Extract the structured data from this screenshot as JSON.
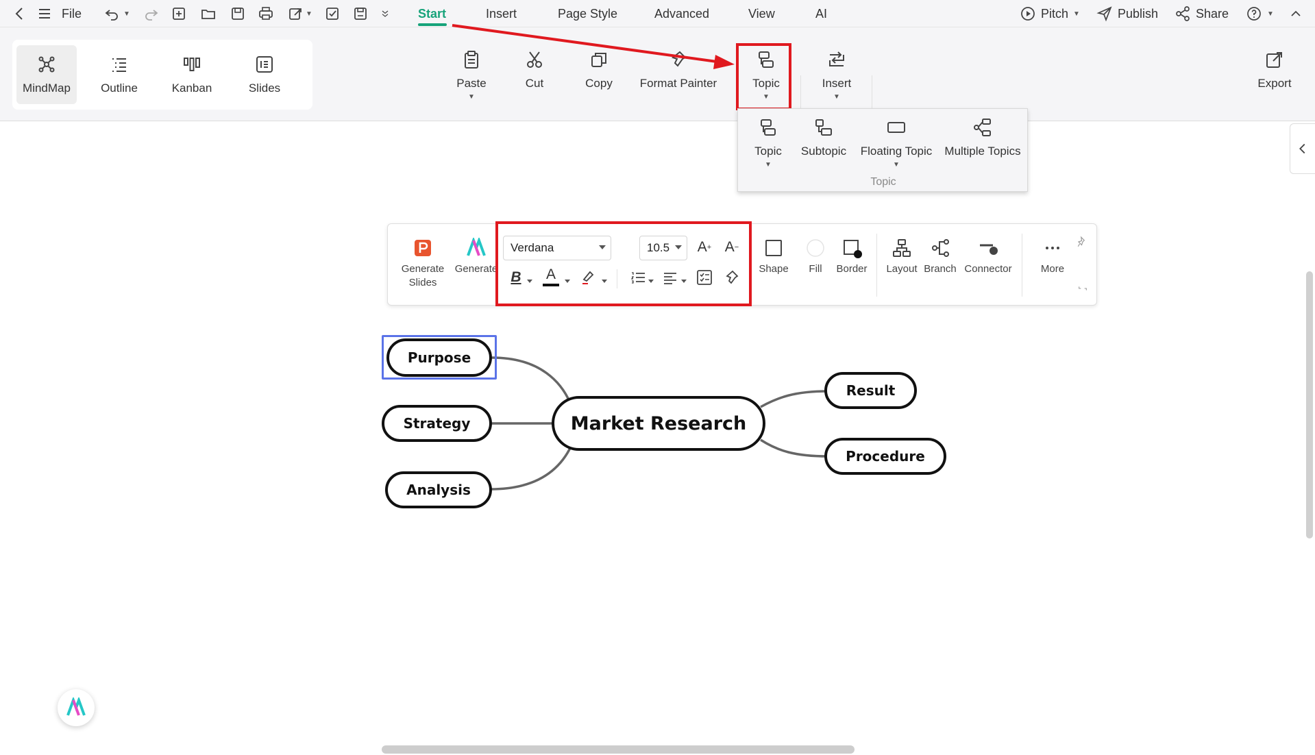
{
  "topbar": {
    "file_label": "File",
    "menus": [
      "Start",
      "Insert",
      "Page Style",
      "Advanced",
      "View",
      "AI"
    ],
    "active_menu": "Start",
    "pitch_label": "Pitch",
    "publish_label": "Publish",
    "share_label": "Share",
    "accent_color": "#17a37a"
  },
  "views": [
    {
      "label": "MindMap",
      "icon": "mindmap-icon",
      "selected": true
    },
    {
      "label": "Outline",
      "icon": "outline-icon"
    },
    {
      "label": "Kanban",
      "icon": "kanban-icon"
    },
    {
      "label": "Slides",
      "icon": "slides-icon"
    }
  ],
  "ribbon": {
    "paste": "Paste",
    "cut": "Cut",
    "copy": "Copy",
    "format_painter": "Format Painter",
    "topic": "Topic",
    "insert": "Insert",
    "export": "Export"
  },
  "topic_dropdown": {
    "items": [
      "Topic",
      "Subtopic",
      "Floating Topic",
      "Multiple Topics"
    ],
    "caption": "Topic"
  },
  "toolbar": {
    "generate_slides": "Generate Slides",
    "generate": "Generate",
    "font": "Verdana",
    "font_size": "10.5",
    "shape": "Shape",
    "fill": "Fill",
    "border": "Border",
    "layout": "Layout",
    "branch": "Branch",
    "connector": "Connector",
    "more": "More"
  },
  "mindmap": {
    "central": "Market Research",
    "left": [
      "Purpose",
      "Strategy",
      "Analysis"
    ],
    "right": [
      "Result",
      "Procedure"
    ],
    "selected": "Purpose",
    "selection_color": "#5b73e8"
  },
  "annotation_color": "#e0191f"
}
